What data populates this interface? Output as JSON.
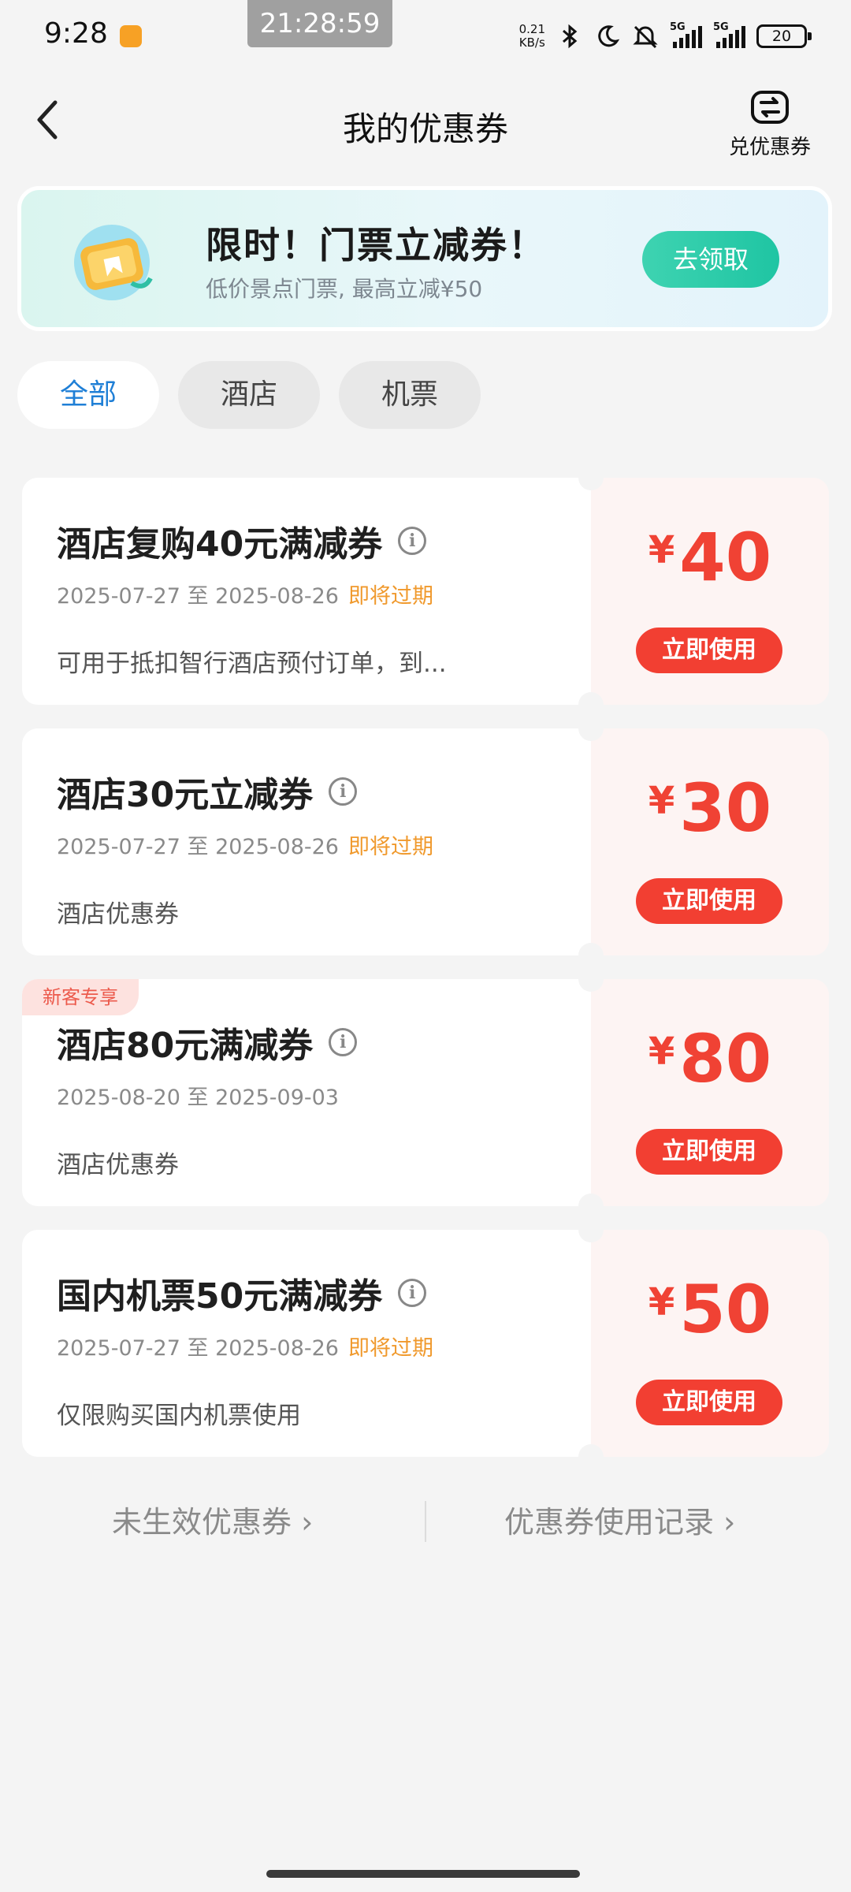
{
  "status_bar": {
    "time": "9:28",
    "clock_overlay": "21:28:59",
    "net_speed_value": "0.21",
    "net_speed_unit": "KB/s",
    "signal1_label": "5G",
    "signal2_label": "5G",
    "battery": "20"
  },
  "nav": {
    "title": "我的优惠券",
    "exchange_label": "兑优惠券"
  },
  "banner": {
    "title": "限时！门票立减券！",
    "subtitle": "低价景点门票, 最高立减¥50",
    "button": "去领取"
  },
  "tabs": [
    {
      "label": "全部",
      "active": true
    },
    {
      "label": "酒店",
      "active": false
    },
    {
      "label": "机票",
      "active": false
    }
  ],
  "coupons": [
    {
      "name": "酒店复购40元满减券",
      "date_range": "2025-07-27 至 2025-08-26",
      "expire_note": "即将过期",
      "desc": "可用于抵扣智行酒店预付订单，到...",
      "currency": "¥",
      "amount": "40",
      "button": "立即使用"
    },
    {
      "name": "酒店30元立减券",
      "date_range": "2025-07-27 至 2025-08-26",
      "expire_note": "即将过期",
      "desc": "酒店优惠券",
      "currency": "¥",
      "amount": "30",
      "button": "立即使用"
    },
    {
      "tag": "新客专享",
      "name": "酒店80元满减券",
      "date_range": "2025-08-20 至 2025-09-03",
      "desc": "酒店优惠券",
      "currency": "¥",
      "amount": "80",
      "button": "立即使用"
    },
    {
      "name": "国内机票50元满减券",
      "date_range": "2025-07-27 至 2025-08-26",
      "expire_note": "即将过期",
      "desc": "仅限购买国内机票使用",
      "currency": "¥",
      "amount": "50",
      "button": "立即使用"
    }
  ],
  "footer": {
    "left_link": "未生效优惠券 ›",
    "right_link": "优惠券使用记录 ›"
  },
  "colors": {
    "accent_blue": "#1f7fd6",
    "coupon_red": "#f04234",
    "expire_orange": "#f0992c",
    "banner_green": "#1fc5a3"
  },
  "icons": [
    "back-arrow-icon",
    "exchange-icon",
    "ticket-icon",
    "info-icon",
    "bluetooth-icon",
    "moon-icon",
    "mute-icon"
  ]
}
